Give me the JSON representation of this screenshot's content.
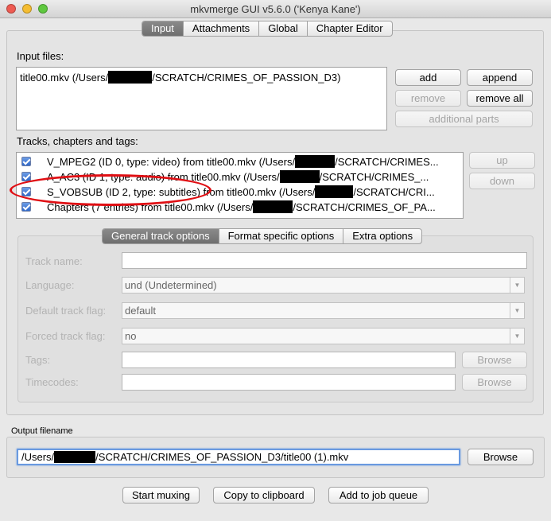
{
  "window": {
    "title": "mkvmerge GUI v5.6.0 ('Kenya Kane')",
    "traffic_lights": [
      {
        "name": "close-button",
        "color": "#ee5b52"
      },
      {
        "name": "minimize-button",
        "color": "#f5bd32"
      },
      {
        "name": "zoom-button",
        "color": "#5fc83f"
      }
    ]
  },
  "main_tabs": [
    "Input",
    "Attachments",
    "Global",
    "Chapter Editor"
  ],
  "input": {
    "input_files_label": "Input files:",
    "files": [
      {
        "prefix": "title00.mkv (/Users/",
        "suffix": "/SCRATCH/CRIMES_OF_PASSION_D3)"
      }
    ],
    "buttons": {
      "add": "add",
      "append": "append",
      "remove": "remove",
      "remove_all": "remove all",
      "additional_parts": "additional parts"
    },
    "tracks_label": "Tracks, chapters and tags:",
    "tracks": [
      {
        "prefix": "V_MPEG2 (ID 0, type: video) from title00.mkv (/Users/",
        "suffix": "/SCRATCH/CRIMES...",
        "checked": true
      },
      {
        "prefix": "A_AC3 (ID 1, type: audio) from title00.mkv (/Users/",
        "suffix": "/SCRATCH/CRIMES_...",
        "checked": true
      },
      {
        "prefix": "S_VOBSUB (ID 2, type: subtitles) from title00.mkv (/Users/",
        "suffix": "/SCRATCH/CRI...",
        "checked": true
      },
      {
        "prefix": "Chapters (7 entries) from title00.mkv (/Users/",
        "suffix": "/SCRATCH/CRIMES_OF_PA...",
        "checked": true
      }
    ],
    "track_buttons": {
      "up": "up",
      "down": "down"
    }
  },
  "track_options": {
    "tabs": [
      "General track options",
      "Format specific options",
      "Extra options"
    ],
    "fields": {
      "track_name": {
        "label": "Track name:",
        "value": ""
      },
      "language": {
        "label": "Language:",
        "value": "und (Undetermined)"
      },
      "default_track": {
        "label": "Default track flag:",
        "value": "default"
      },
      "forced_track": {
        "label": "Forced track flag:",
        "value": "no"
      },
      "tags": {
        "label": "Tags:",
        "value": "",
        "browse": "Browse"
      },
      "timecodes": {
        "label": "Timecodes:",
        "value": "",
        "browse": "Browse"
      }
    }
  },
  "output": {
    "label": "Output filename",
    "prefix": "/Users/",
    "suffix": "/SCRATCH/CRIMES_OF_PASSION_D3/title00 (1).mkv",
    "browse": "Browse"
  },
  "actions": {
    "start_muxing": "Start muxing",
    "copy_to_clipboard": "Copy to clipboard",
    "add_to_job_queue": "Add to job queue"
  },
  "annotation": {
    "shape": "ellipse",
    "color": "#e00f14",
    "target": "S_VOBSUB track row"
  }
}
